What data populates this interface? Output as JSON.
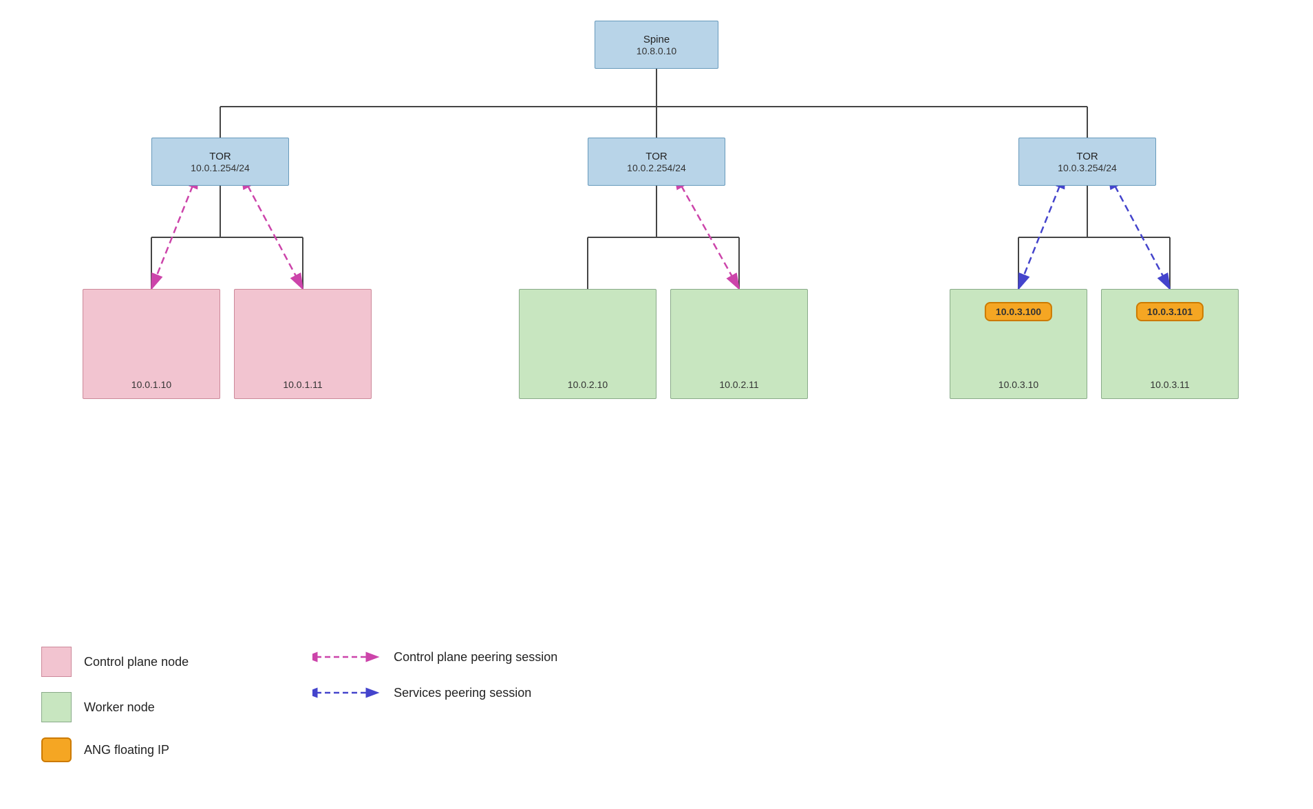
{
  "spine": {
    "label": "Spine",
    "ip": "10.8.0.10"
  },
  "tors": [
    {
      "label": "TOR",
      "ip": "10.0.1.254/24"
    },
    {
      "label": "TOR",
      "ip": "10.0.2.254/24"
    },
    {
      "label": "TOR",
      "ip": "10.0.3.254/24"
    }
  ],
  "nodes_left": [
    {
      "ip": "10.0.1.10",
      "type": "control"
    },
    {
      "ip": "10.0.1.11",
      "type": "control"
    }
  ],
  "nodes_mid": [
    {
      "ip": "10.0.2.10",
      "type": "worker"
    },
    {
      "ip": "10.0.2.11",
      "type": "worker"
    }
  ],
  "nodes_right": [
    {
      "ip": "10.0.3.10",
      "type": "worker",
      "floating_ip": "10.0.3.100"
    },
    {
      "ip": "10.0.3.11",
      "type": "worker",
      "floating_ip": "10.0.3.101"
    }
  ],
  "legend": {
    "control_label": "Control plane node",
    "worker_label": "Worker node",
    "ang_label": "ANG floating IP",
    "arrow1_label": "Control plane peering session",
    "arrow2_label": "Services peering session"
  }
}
